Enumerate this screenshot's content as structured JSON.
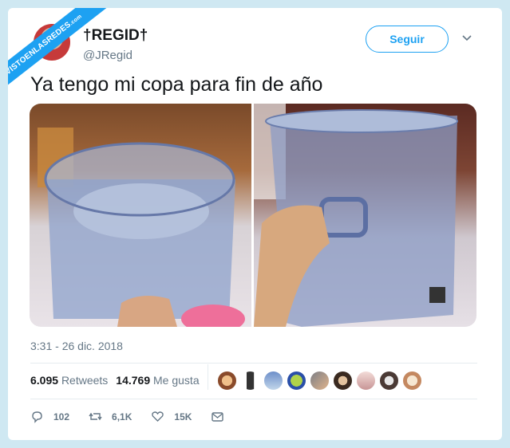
{
  "watermark": {
    "main": "VISTOENLASREDES",
    "suffix": ".com"
  },
  "user": {
    "display_name": "†REGID†",
    "handle": "@JRegid"
  },
  "follow_label": "Seguir",
  "tweet": {
    "text": "Ya tengo mi copa para fin de año",
    "timestamp": "3:31 - 26 dic. 2018"
  },
  "stats": {
    "retweets_count": "6.095",
    "retweets_label": "Retweets",
    "likes_count": "14.769",
    "likes_label": "Me gusta"
  },
  "actions": {
    "replies": "102",
    "retweets": "6,1K",
    "likes": "15K"
  },
  "colors": {
    "accent": "#1da1f2",
    "text": "#14171a",
    "muted": "#657786"
  },
  "icons": {
    "more": "chevron-down-icon",
    "reply": "reply-icon",
    "retweet": "retweet-icon",
    "like": "heart-icon",
    "message": "envelope-icon"
  }
}
